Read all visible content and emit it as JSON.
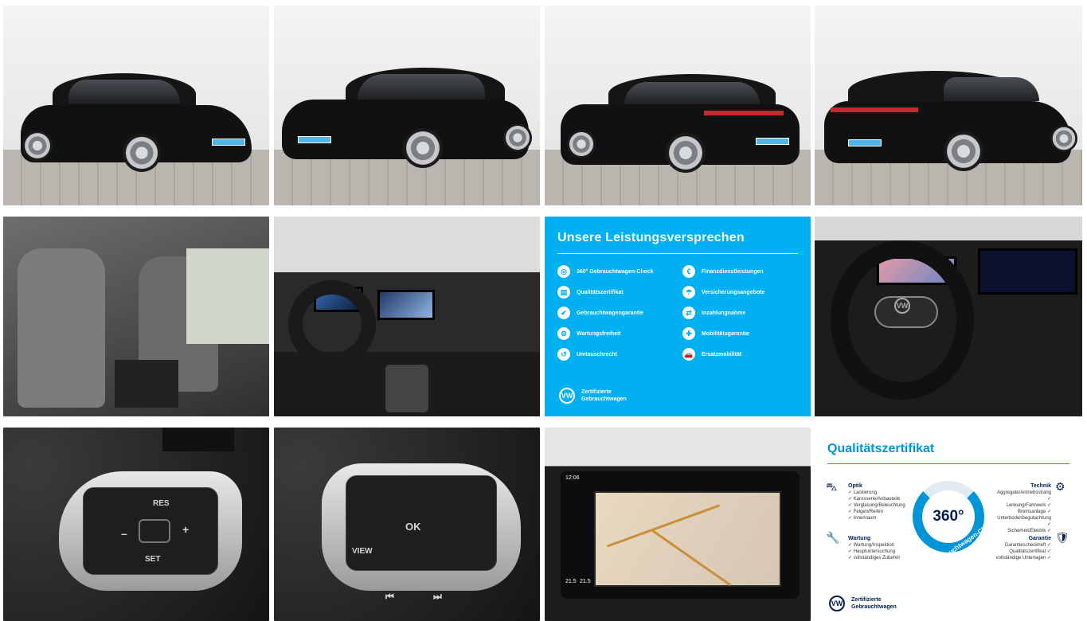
{
  "gallery": {
    "promise_card": {
      "title": "Unsere Leistungsversprechen",
      "items_left": [
        "360° Gebrauchtwagen-Check",
        "Qualitätszertifikat",
        "Gebrauchtwagengarantie",
        "Wartungsfreiheit",
        "Umtauschrecht"
      ],
      "items_right": [
        "Finanzdienstleistungen",
        "Versicherungsangebote",
        "Inzahlungnahme",
        "Mobilitätsgarantie",
        "Ersatzmobilität"
      ],
      "brand_line1": "Zertifizierte",
      "brand_line2": "Gebrauchtwagen",
      "accent": "#00b0f0"
    },
    "certificate_card": {
      "title": "Qualitätszertifikat",
      "ring_value": "360°",
      "ring_caption": "Gebrauchtwagen-Check",
      "optik": {
        "label": "Optik",
        "lines": [
          "✓ Lackierung",
          "✓ Karosserie/Anbauteile",
          "✓ Verglasung/Beleuchtung",
          "✓ Felgen/Reifen",
          "✓ Innenraum"
        ]
      },
      "wartung": {
        "label": "Wartung",
        "lines": [
          "✓ Wartung/Inspektion",
          "✓ Hauptuntersuchung",
          "✓ vollständiges Zubehör"
        ]
      },
      "technik": {
        "label": "Technik",
        "lines": [
          "Aggregate/Antriebsstrang ✓",
          "Lenkung/Fahrwerk ✓",
          "Bremsanlage ✓",
          "Unterbodenbegutachtung ✓",
          "Sicherheit/Elektrik ✓"
        ]
      },
      "garantie": {
        "label": "Garantie",
        "lines": [
          "Garantiescheckheft ✓",
          "Qualitätszertifikat ✓",
          "vollständige Unterlagen ✓"
        ]
      },
      "brand_line1": "Zertifizierte",
      "brand_line2": "Gebrauchtwagen",
      "accent": "#0095d9"
    },
    "wheel_left_buttons": {
      "res": "RES",
      "set": "SET",
      "plus": "+",
      "minus": "–"
    },
    "wheel_right_buttons": {
      "ok": "OK",
      "view": "VIEW"
    },
    "nav_screen": {
      "time": "12:06",
      "temp_left": "21.5",
      "temp_right": "21.5"
    },
    "vw_logo": "VW"
  }
}
